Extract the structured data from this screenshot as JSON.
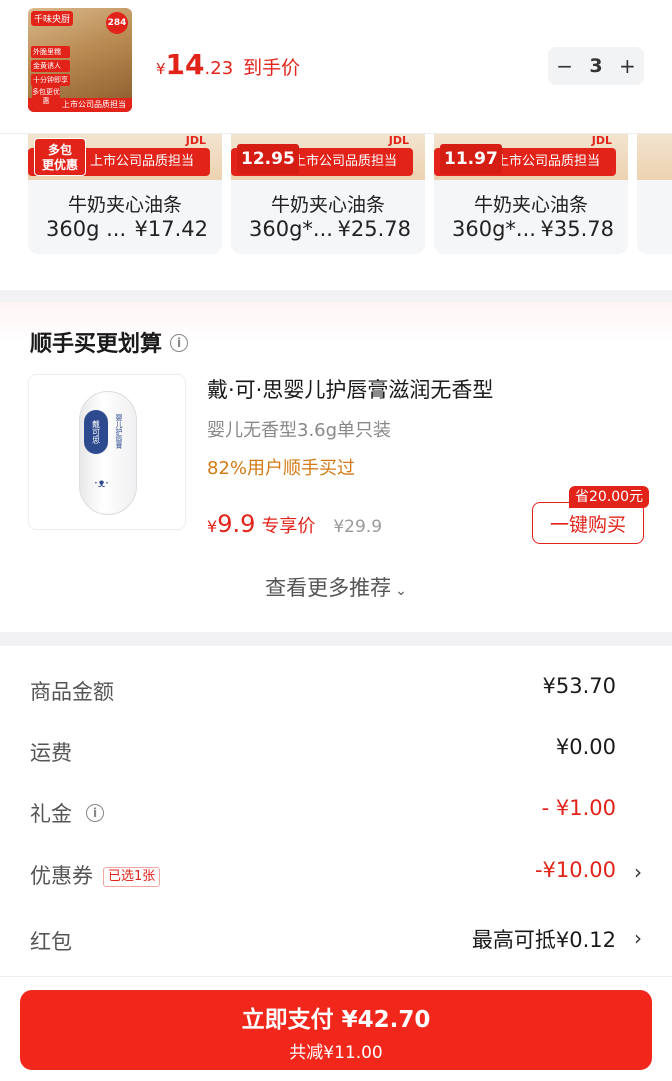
{
  "top_product": {
    "image_badges": {
      "corner": "千味央厨",
      "count": "284",
      "tags": [
        "外脆里糯",
        "金黄诱人",
        "十分钟即享"
      ],
      "package_label": "多包更优惠",
      "strip_text": "上市公司品质担当"
    },
    "price_currency": "¥",
    "price_integer": "14",
    "price_decimal": ".23",
    "price_suffix": "到手价",
    "quantity": "3",
    "minus_symbol": "−",
    "plus_symbol": "+"
  },
  "similar_products": [
    {
      "banner_left": "多包\n更优惠",
      "banner_label": "上市公司品质担当",
      "logo": "JDL",
      "name": "牛奶夹心油条",
      "spec": "360g ...",
      "price": "¥17.42"
    },
    {
      "banner_left": "12.95",
      "banner_label": "上市公司品质担当",
      "logo": "JDL",
      "name": "牛奶夹心油条",
      "spec": "360g*...",
      "price": "¥25.78"
    },
    {
      "banner_left": "11.97",
      "banner_label": "上市公司品质担当",
      "logo": "JDL",
      "name": "牛奶夹心油条",
      "spec": "360g*...",
      "price": "¥35.78"
    }
  ],
  "buy_together": {
    "title": "顺手买更划算",
    "product_name": "戴·可·思婴儿护唇膏滋润无香型",
    "product_spec": "婴儿无香型3.6g单只装",
    "users_text": "82%用户顺手买过",
    "price_currency": "¥",
    "price_value": "9.9",
    "price_label": "专享价",
    "original_price": "¥29.9",
    "save_badge": "省20.00元",
    "buy_button": "一键购买",
    "image_brand": "戴可思",
    "image_side_text": "婴儿护唇膏",
    "more_label": "查看更多推荐"
  },
  "summary": {
    "goods_amount": {
      "label": "商品金额",
      "value": "¥53.70"
    },
    "shipping": {
      "label": "运费",
      "value": "¥0.00"
    },
    "gift_money": {
      "label": "礼金",
      "value": "- ¥1.00"
    },
    "coupon": {
      "label": "优惠券",
      "chip": "已选1张",
      "value": "-¥10.00"
    },
    "red_packet": {
      "label": "红包",
      "value": "最高可抵¥0.12"
    }
  },
  "pay": {
    "label": "立即支付 ¥42.70",
    "sub_label": "共减¥11.00"
  },
  "colors": {
    "accent_red": "#e2231a",
    "users_orange": "#d47a14"
  }
}
